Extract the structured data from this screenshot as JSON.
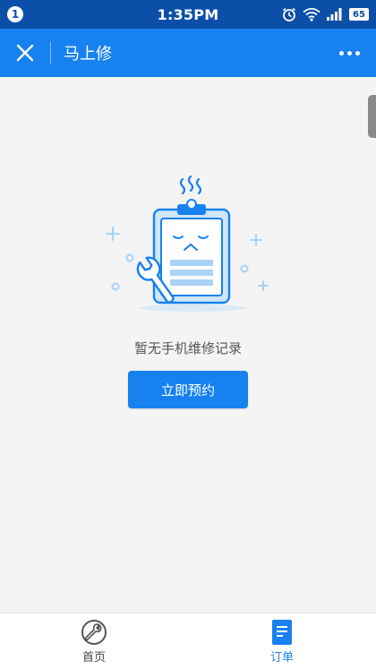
{
  "status_bar": {
    "notification_count": "1",
    "time": "1:35PM",
    "battery": "65",
    "icons": [
      "alarm-icon",
      "wifi-icon",
      "signal-icon",
      "battery-icon"
    ]
  },
  "app_bar": {
    "title": "马上修",
    "close_icon": "close-icon",
    "more_icon": "more-icon"
  },
  "empty_state": {
    "message": "暂无手机维修记录",
    "button_label": "立即预约",
    "illustration": "clipboard-wrench-icon"
  },
  "bottom_nav": {
    "items": [
      {
        "label": "首页",
        "icon": "wrench-home-icon",
        "active": false
      },
      {
        "label": "订单",
        "icon": "order-doc-icon",
        "active": true
      }
    ]
  },
  "colors": {
    "status_bar": "#0b4fa8",
    "primary": "#1781f0",
    "background": "#f4f4f4",
    "illustration_light": "#bfe0fb"
  }
}
